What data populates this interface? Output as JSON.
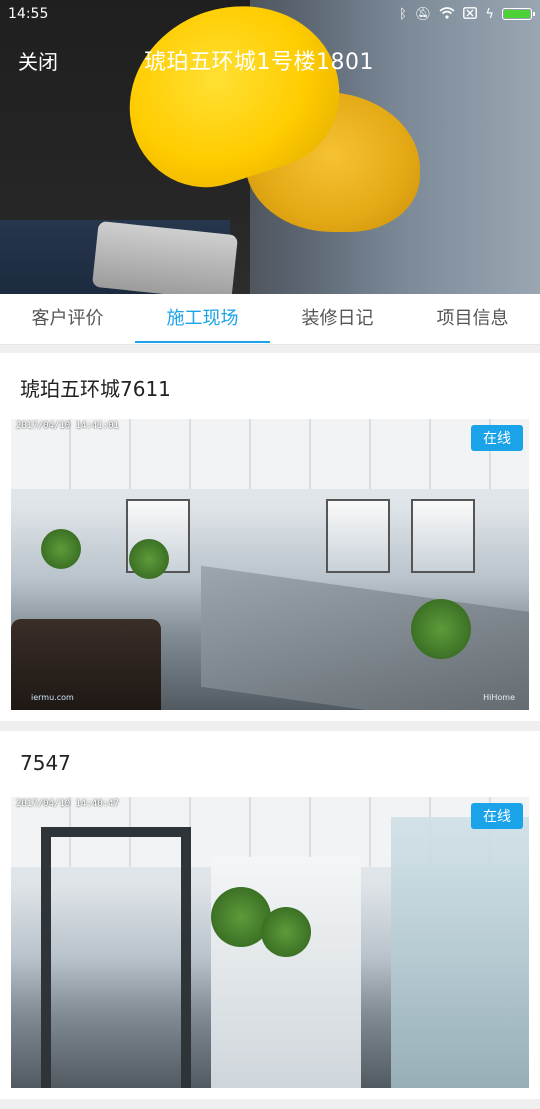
{
  "status_bar": {
    "time": "14:55",
    "icons": [
      "bluetooth-icon",
      "mute-icon",
      "wifi-icon",
      "sim-icon",
      "charging-icon",
      "battery-icon"
    ],
    "battery_level": 1.0
  },
  "header": {
    "close_label": "关闭",
    "title": "琥珀五环城1号楼1801"
  },
  "tabs": [
    {
      "label": "客户评价",
      "active": false
    },
    {
      "label": "施工现场",
      "active": true
    },
    {
      "label": "装修日记",
      "active": false
    },
    {
      "label": "项目信息",
      "active": false
    }
  ],
  "cameras": [
    {
      "name": "琥珀五环城7611",
      "timestamp": "2017/04/10  14:41:01",
      "status": "在线",
      "watermark_left": "iermu.com",
      "watermark_right": "HiHome"
    },
    {
      "name": "7547",
      "timestamp": "2017/04/10  14:40:47",
      "status": "在线"
    }
  ],
  "colors": {
    "accent": "#1aa3e8",
    "battery": "#4cd137"
  }
}
